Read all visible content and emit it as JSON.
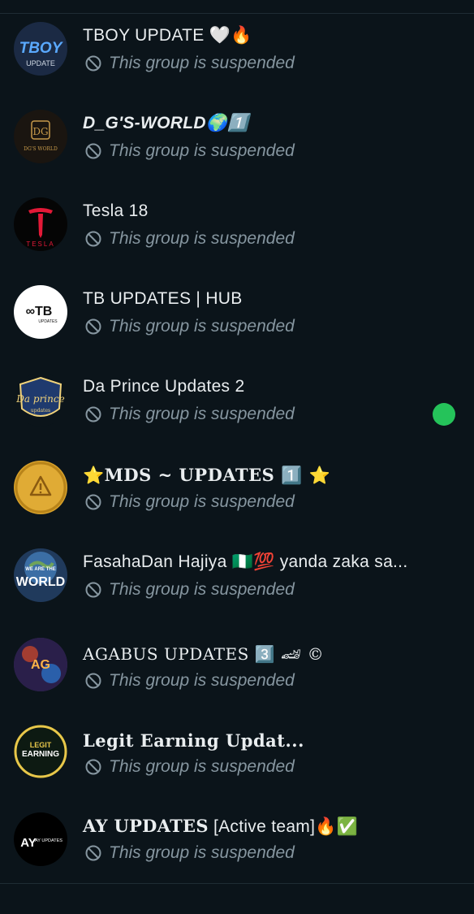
{
  "status_text": "This group is suspended",
  "groups": [
    {
      "name": "TBOY UPDATE 🤍🔥",
      "avatar": {
        "bg": "#1b2a44",
        "text": "TBOY",
        "sub": "UPDATE",
        "color": "#5aa9ff"
      }
    },
    {
      "name": "D_G'S-WORLD🌍1️⃣",
      "avatar": {
        "bg": "#1a1510",
        "text": "DG",
        "sub": "DG'S WORLD",
        "color": "#c69a4a"
      }
    },
    {
      "name": "Tesla 18",
      "avatar": {
        "bg": "#050505",
        "text": "T",
        "sub": "TESLA",
        "color": "#e31937"
      }
    },
    {
      "name": "TB UPDATES | HUB",
      "avatar": {
        "bg": "#ffffff",
        "text": "∞TB",
        "sub": "UPDATES",
        "color": "#111111"
      }
    },
    {
      "name": "Da Prince Updates 2",
      "avatar": {
        "bg": "#1f3a6e",
        "text": "Da prince",
        "sub": "updates",
        "color": "#f0d27a"
      },
      "online": true
    },
    {
      "name": "⭐MDS ~ UPDATES 1️⃣ ⭐",
      "avatar": {
        "bg": "#d9a22a",
        "text": "⚠",
        "sub": "",
        "color": "#8a5a10"
      }
    },
    {
      "name": "FasahaDan Hajiya 🇳🇬💯 yanda zaka sa...",
      "avatar": {
        "bg": "#203a5c",
        "text": "WORLD",
        "sub": "WE ARE THE",
        "color": "#ffffff"
      }
    },
    {
      "name": "AGABUS UPDATES 3️⃣ 🏎 ©",
      "avatar": {
        "bg": "#3a2a5c",
        "text": "AG",
        "sub": "",
        "color": "#ffb347"
      }
    },
    {
      "name": "Legit Earning Updat...",
      "avatar": {
        "bg": "#0d1a12",
        "text": "EARNING",
        "sub": "LEGIT",
        "color": "#e8c74a"
      }
    },
    {
      "name": "AY UPDATES [Active team]🔥✅",
      "avatar": {
        "bg": "#000000",
        "text": "AY",
        "sub": "AY UPDATES",
        "color": "#ffffff"
      }
    }
  ],
  "colors": {
    "background": "#0b141a",
    "online": "#25c35a",
    "muted": "#8696a0"
  }
}
